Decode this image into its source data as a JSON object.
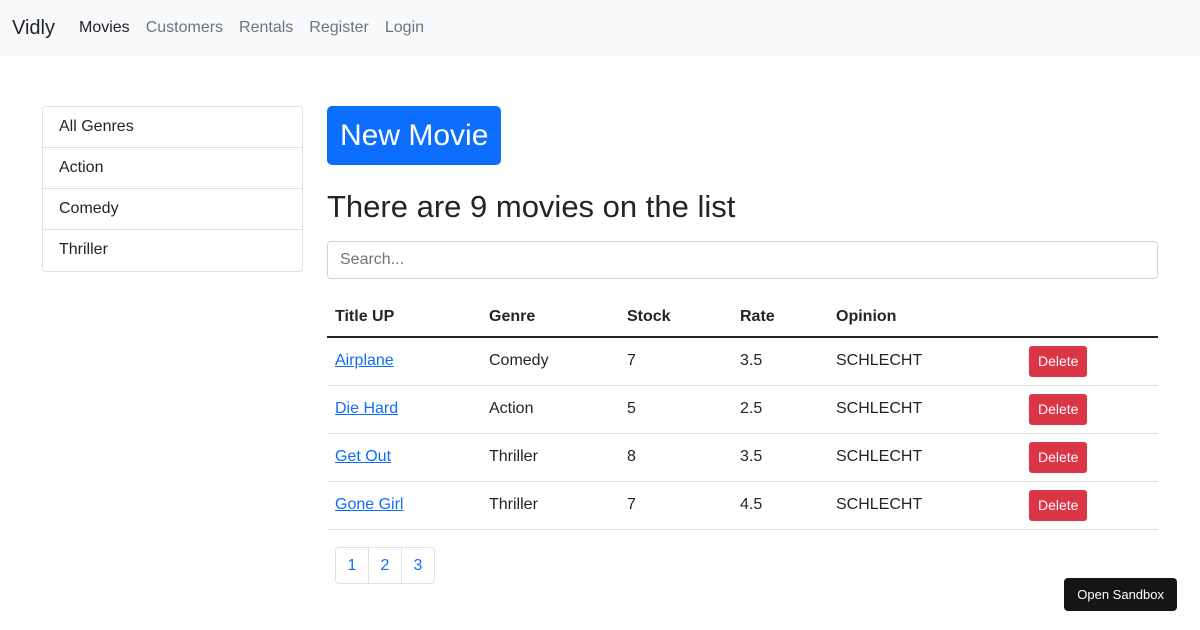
{
  "navbar": {
    "brand": "Vidly",
    "links": [
      "Movies",
      "Customers",
      "Rentals",
      "Register",
      "Login"
    ],
    "active": "Movies"
  },
  "sidebar": {
    "genres": [
      "All Genres",
      "Action",
      "Comedy",
      "Thriller"
    ]
  },
  "main": {
    "new_button": "New Movie",
    "count_text": "There are 9 movies on the list",
    "search_placeholder": "Search...",
    "table": {
      "headers": [
        "Title UP",
        "Genre",
        "Stock",
        "Rate",
        "Opinion"
      ],
      "rows": [
        {
          "title": "Airplane",
          "genre": "Comedy",
          "stock": "7",
          "rate": "3.5",
          "opinion": "SCHLECHT",
          "action": "Delete"
        },
        {
          "title": "Die Hard",
          "genre": "Action",
          "stock": "5",
          "rate": "2.5",
          "opinion": "SCHLECHT",
          "action": "Delete"
        },
        {
          "title": "Get Out",
          "genre": "Thriller",
          "stock": "8",
          "rate": "3.5",
          "opinion": "SCHLECHT",
          "action": "Delete"
        },
        {
          "title": "Gone Girl",
          "genre": "Thriller",
          "stock": "7",
          "rate": "4.5",
          "opinion": "SCHLECHT",
          "action": "Delete"
        }
      ]
    },
    "pagination": [
      "1",
      "2",
      "3"
    ]
  },
  "sandbox_button": "Open Sandbox",
  "colors": {
    "primary": "#0d6efd",
    "danger": "#dc3545",
    "navbar_bg": "#f8f9fa"
  }
}
